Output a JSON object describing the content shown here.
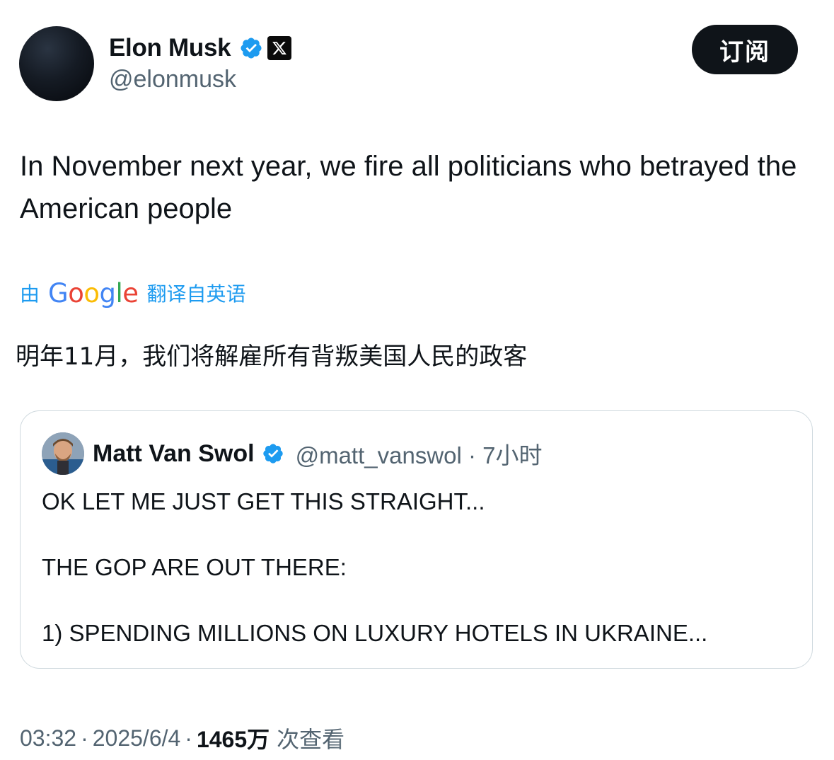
{
  "author": {
    "name": "Elon Musk",
    "handle": "@elonmusk",
    "verified_icon": "verified-badge-icon",
    "affiliation_icon": "x-logo-icon"
  },
  "subscribe_label": "订阅",
  "tweet": {
    "text": "In November next year, we fire all politicians who betrayed the American people"
  },
  "translation": {
    "by": "由",
    "provider": "Google",
    "suffix": "翻译自英语",
    "text": "明年11月，我们将解雇所有背叛美国人民的政客"
  },
  "quoted_tweet": {
    "name": "Matt Van Swol",
    "handle": "@matt_vanswol · 7小时",
    "text": "OK LET ME JUST GET THIS STRAIGHT...\n\nTHE GOP ARE OUT THERE:\n\n1) SPENDING MILLIONS ON LUXURY HOTELS IN UKRAINE..."
  },
  "meta": {
    "time": "03:32",
    "date": "2025/6/4",
    "views": "1465万",
    "views_label": "次查看"
  },
  "colors": {
    "accent": "#1d9bf0",
    "text": "#0f1419",
    "muted": "#536471",
    "border": "#cfd9de"
  }
}
